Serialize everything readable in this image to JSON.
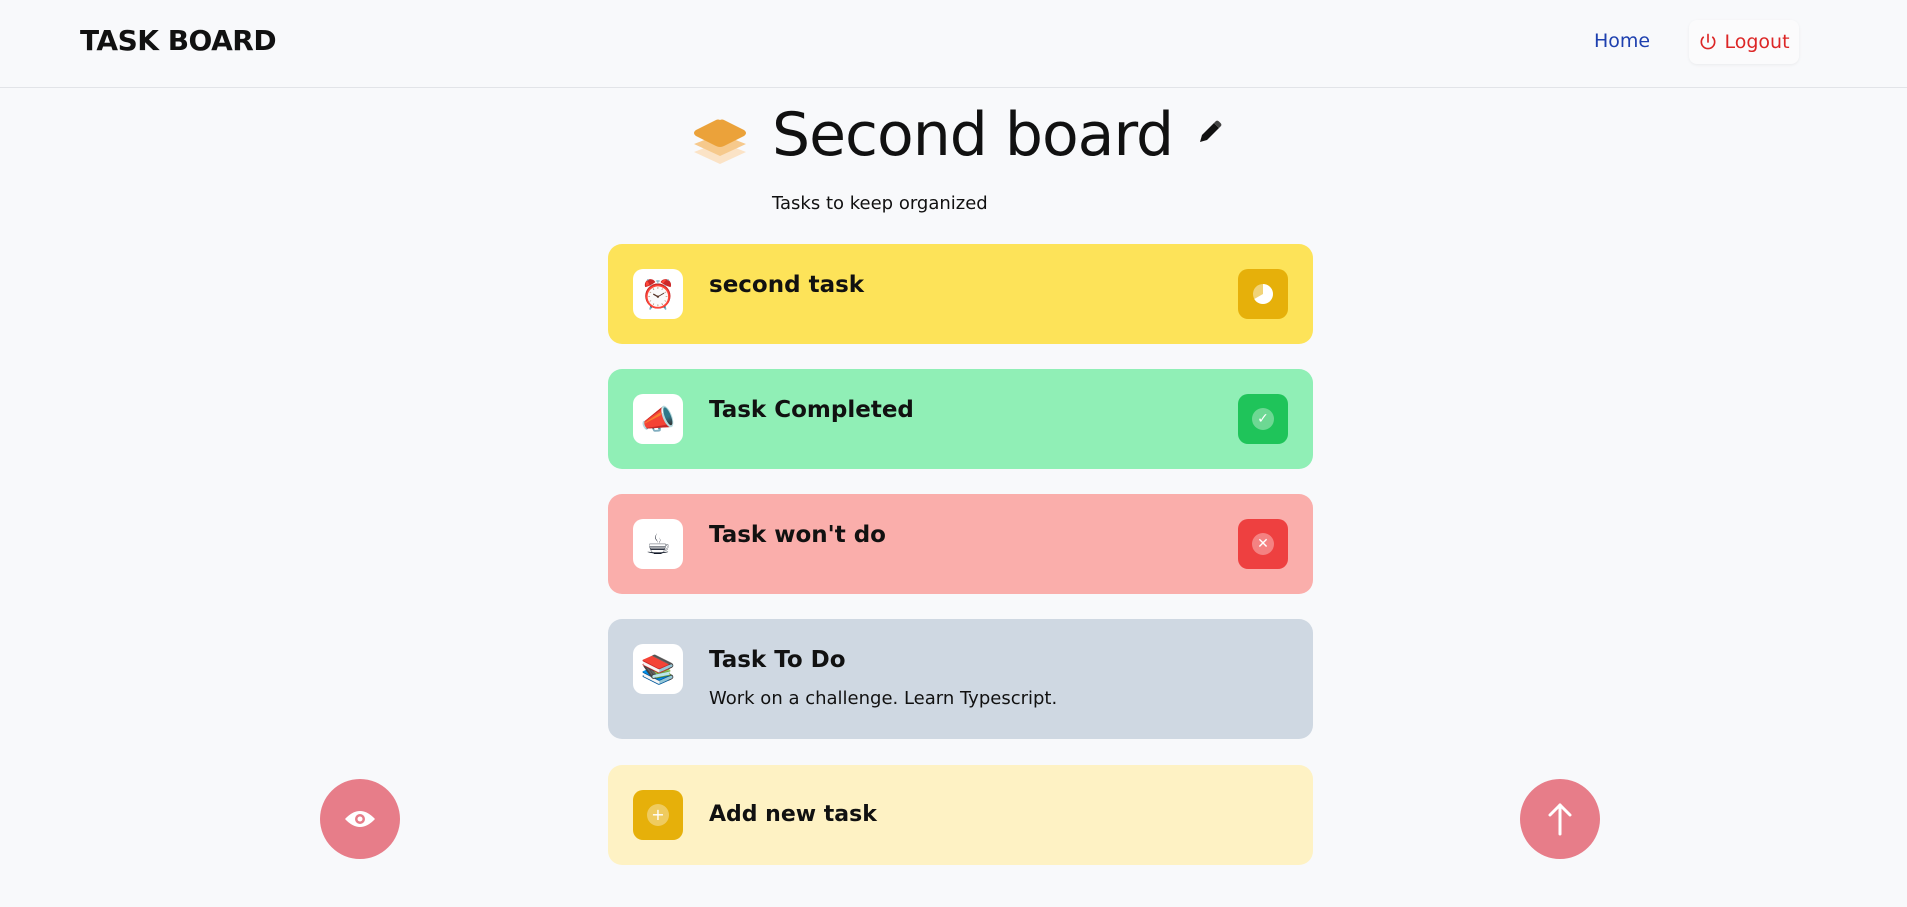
{
  "header": {
    "brand": "TASK BOARD",
    "nav_home": "Home",
    "nav_logout": "Logout",
    "logout_icon": "power-icon"
  },
  "board": {
    "title": "Second board",
    "description": "Tasks to keep organized",
    "logo_icon": "layers-icon",
    "edit_icon": "pencil-icon"
  },
  "tasks": [
    {
      "title": "second task",
      "description": "",
      "icon": "⏰",
      "status": "in-progress",
      "status_icon": "progress-icon",
      "color": "#fde359"
    },
    {
      "title": "Task Completed",
      "description": "",
      "icon": "📣",
      "status": "completed",
      "status_icon": "check-icon",
      "color": "#90efb6"
    },
    {
      "title": "Task won't do",
      "description": "",
      "icon": "☕",
      "status": "wont-do",
      "status_icon": "close-icon",
      "color": "#faaeab"
    },
    {
      "title": "Task To Do",
      "description": "Work on a challenge. Learn Typescript.",
      "icon": "📚",
      "status": "todo",
      "status_icon": "",
      "color": "#cfd8e2"
    }
  ],
  "add_task": {
    "label": "Add new task",
    "icon": "plus-icon"
  },
  "fabs": {
    "left_icon": "eye-icon",
    "right_icon": "arrow-up-icon",
    "color": "#e77d89"
  }
}
